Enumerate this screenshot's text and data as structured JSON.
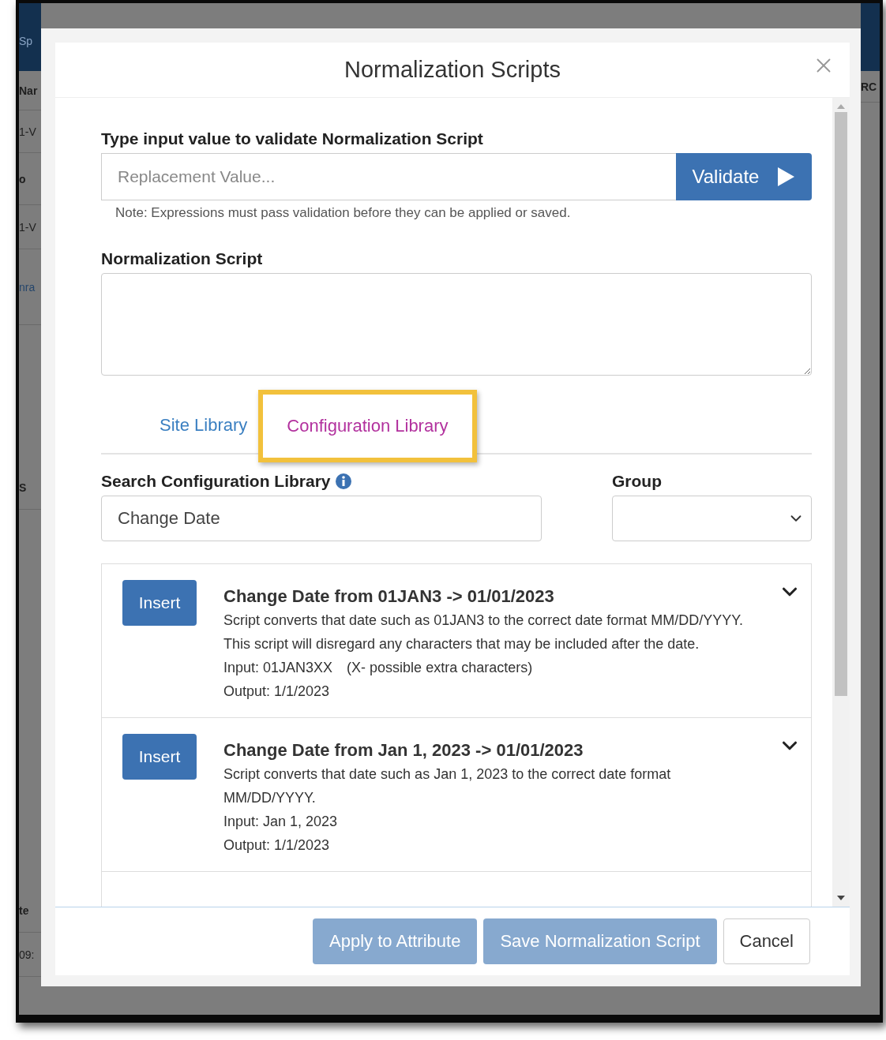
{
  "background": {
    "left_fragments": [
      {
        "text": "Sp",
        "kind": "header"
      },
      {
        "text": "Nar",
        "kind": "label"
      },
      {
        "text": "1-V",
        "kind": "value"
      },
      {
        "text": "o",
        "kind": "label"
      },
      {
        "text": "1-V",
        "kind": "value"
      },
      {
        "text": "nra",
        "kind": "link"
      },
      {
        "text": "S",
        "kind": "label"
      },
      {
        "text": "te",
        "kind": "label"
      },
      {
        "text": "09:",
        "kind": "value"
      }
    ],
    "right_fragment": "RC"
  },
  "modal": {
    "title": "Normalization Scripts",
    "validate": {
      "label": "Type input value to validate Normalization Script",
      "placeholder": "Replacement Value...",
      "button": "Validate",
      "note": "Note: Expressions must pass validation before they can be applied or saved."
    },
    "script": {
      "label": "Normalization Script"
    },
    "tabs": [
      {
        "label": "Site Library",
        "selected": false
      },
      {
        "label": "Configuration Library",
        "selected": true
      }
    ],
    "search": {
      "label": "Search Configuration Library",
      "value": "Change Date"
    },
    "group": {
      "label": "Group"
    },
    "scripts": [
      {
        "button": "Insert",
        "title": "Change Date from 01JAN3 -> 01/01/2023",
        "description": "Script converts that date such as 01JAN3 to the correct date format MM/DD/YYYY. This script will disregard any characters that may be included after the date.",
        "input": "Input: 01JAN3XX",
        "input_note": "(X- possible extra characters)",
        "output": "Output: 1/1/2023"
      },
      {
        "button": "Insert",
        "title": "Change Date from Jan 1, 2023 -> 01/01/2023",
        "description": "Script converts that date such as Jan 1, 2023 to the correct date format MM/DD/YYYY.",
        "input": "Input: Jan 1, 2023",
        "output": "Output: 1/1/2023"
      }
    ],
    "buttons": [
      {
        "label": "Apply to Attribute",
        "kind": "primary",
        "disabled": true
      },
      {
        "label": "Save Normalization Script",
        "kind": "primary",
        "disabled": true
      },
      {
        "label": "Cancel",
        "kind": "default",
        "disabled": false
      }
    ]
  }
}
